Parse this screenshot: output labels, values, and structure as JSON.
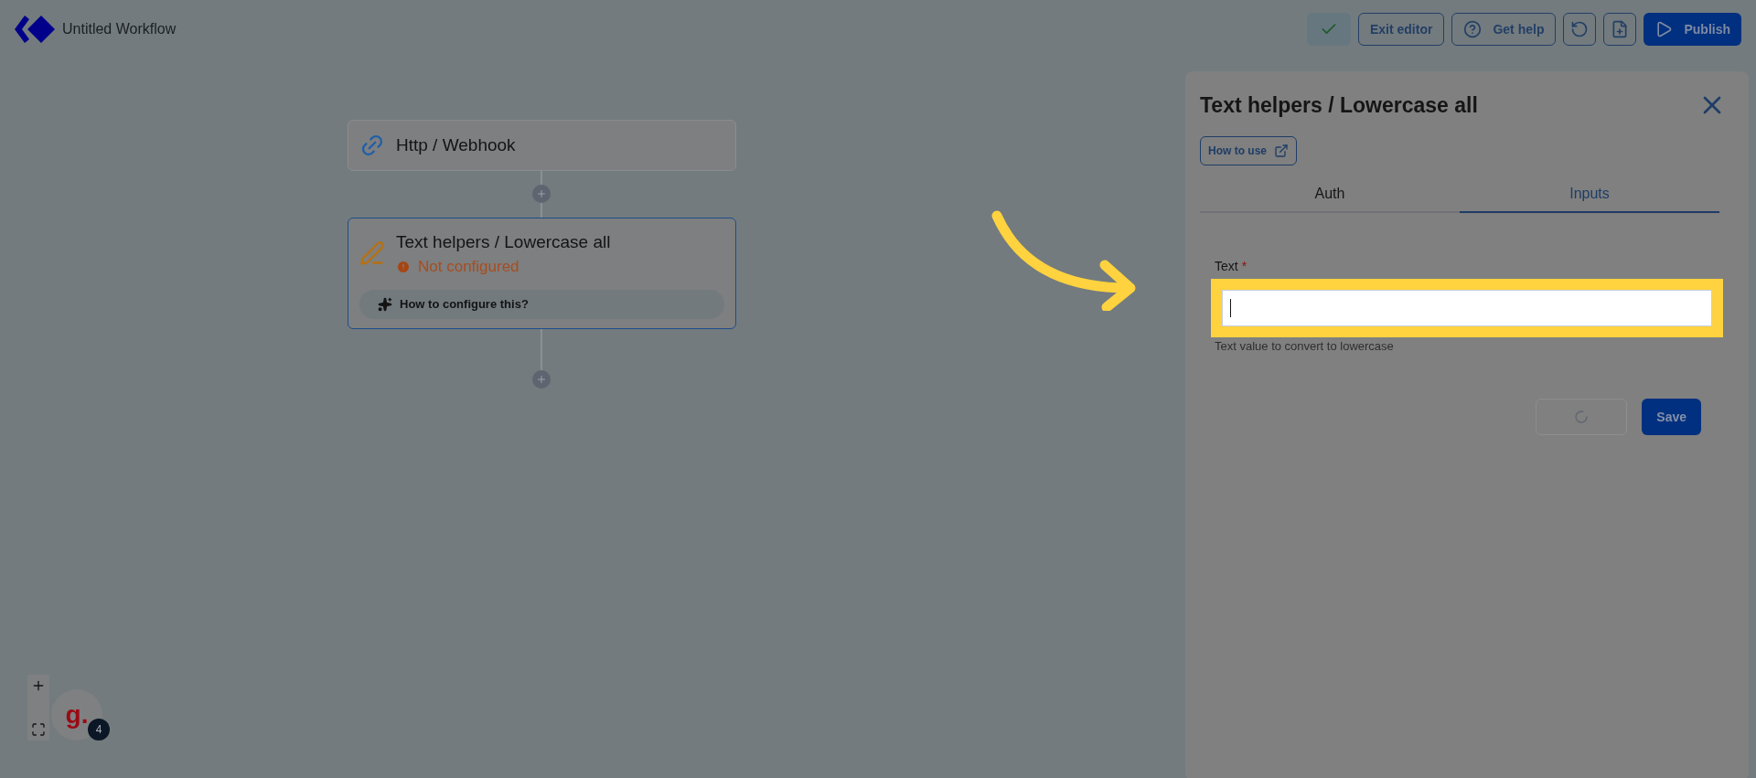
{
  "header": {
    "title": "Untitled Workflow",
    "buttons": [
      {
        "kind": "check"
      },
      {
        "kind": "outline",
        "label": "Exit editor"
      },
      {
        "kind": "help",
        "label": "Get help"
      },
      {
        "kind": "history"
      },
      {
        "kind": "file-add"
      },
      {
        "kind": "publish",
        "label": "Publish"
      }
    ]
  },
  "canvas": {
    "nodes": [
      {
        "kind": "trigger",
        "title": "Http / Webhook"
      },
      {
        "kind": "action",
        "title": "Text helpers / Lowercase all",
        "selected": true,
        "status": "Not configured",
        "help": "How to configure this?"
      }
    ],
    "user": {
      "initial": "g.",
      "badge": "4"
    }
  },
  "panel": {
    "title": "Text helpers / Lowercase all",
    "link": "How to use",
    "tabs": [
      {
        "label": "Auth",
        "selected": false
      },
      {
        "label": "Inputs",
        "selected": true
      }
    ],
    "field": {
      "label": "Text",
      "required_mark": "*",
      "hint": "Text value to convert to lowercase",
      "highlighted": true
    },
    "actions": [
      {
        "kind": "loading"
      },
      {
        "kind": "primary",
        "label": "Save"
      }
    ]
  }
}
